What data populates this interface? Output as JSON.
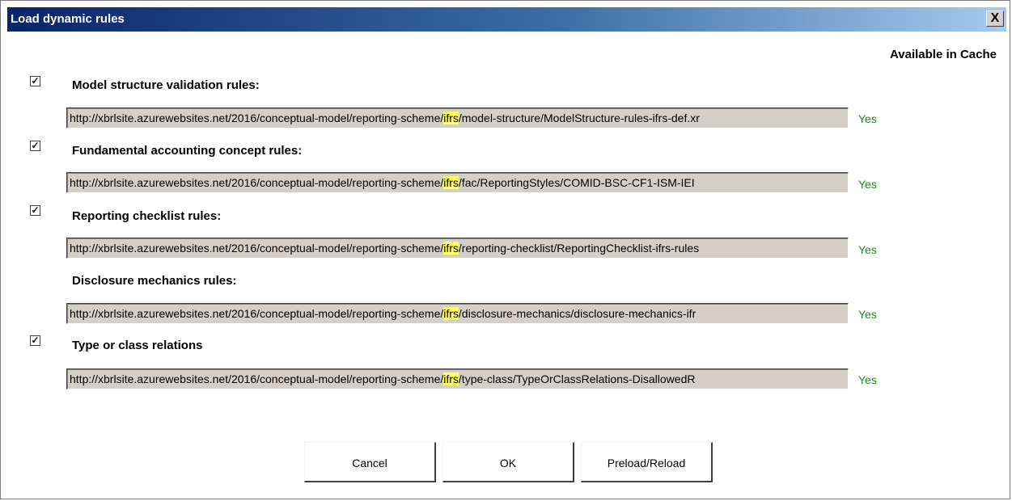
{
  "window": {
    "title": "Load dynamic rules",
    "close_symbol": "X"
  },
  "cache_header": "Available in Cache",
  "url_prefix": "http://xbrlsite.azurewebsites.net/2016/conceptual-model/reporting-scheme/",
  "highlight": "ifrs",
  "rules": [
    {
      "label": "Model structure validation rules:",
      "checked": true,
      "url_rest": "/model-structure/ModelStructure-rules-ifrs-def.xr",
      "cache": "Yes"
    },
    {
      "label": "Fundamental accounting concept rules:",
      "checked": true,
      "url_rest": "/fac/ReportingStyles/COMID-BSC-CF1-ISM-IEI",
      "cache": "Yes"
    },
    {
      "label": "Reporting checklist rules:",
      "checked": true,
      "url_rest": "/reporting-checklist/ReportingChecklist-ifrs-rules",
      "cache": "Yes"
    },
    {
      "label": "Disclosure mechanics rules:",
      "checked": null,
      "url_rest": "/disclosure-mechanics/disclosure-mechanics-ifr",
      "cache": "Yes"
    },
    {
      "label": "Type or class relations",
      "checked": true,
      "url_rest": "/type-class/TypeOrClassRelations-DisallowedR",
      "cache": "Yes"
    }
  ],
  "buttons": {
    "cancel": "Cancel",
    "ok": "OK",
    "preload": "Preload/Reload"
  },
  "check_mark": "✓"
}
